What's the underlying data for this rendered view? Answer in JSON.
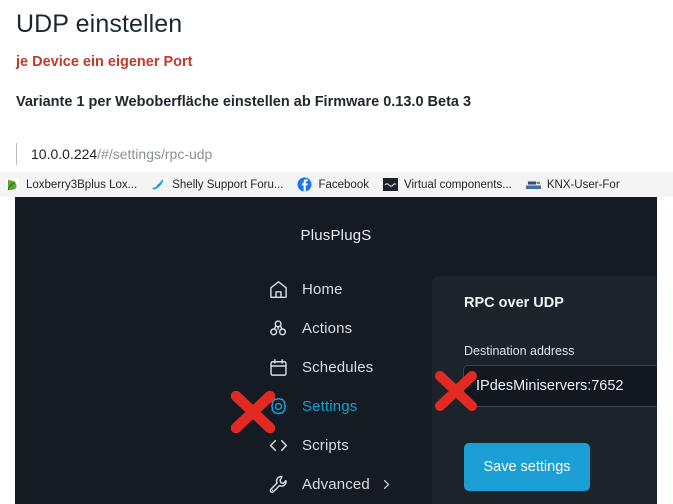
{
  "document": {
    "title": "UDP einstellen",
    "subtitle_red": "je Device ein eigener Port",
    "subtitle_dark": "Variante 1 per Weboberfläche einstellen ab Firmware 0.13.0 Beta 3",
    "colors": {
      "title": "#1b2733",
      "red": "#c0392b",
      "dark": "#20282f"
    }
  },
  "browser": {
    "url_host": "10.0.0.224",
    "url_path": "/#/settings/rpc-udp",
    "bookmarks": [
      {
        "label": "Loxberry3Bplus Lox...",
        "icon": "loxberry-leaf-icon"
      },
      {
        "label": "Shelly Support Foru...",
        "icon": "rss-feed-icon"
      },
      {
        "label": "Facebook",
        "icon": "facebook-icon"
      },
      {
        "label": "Virtual components...",
        "icon": "dark-square-icon"
      },
      {
        "label": "KNX-User-For",
        "icon": "knx-banner-icon"
      }
    ]
  },
  "app": {
    "device_name": "PlusPlugS",
    "colors": {
      "page_bg": "#141b22",
      "card_bg": "#1b232b",
      "accent": "#1b9fd4",
      "annotation_red": "#e32a22"
    },
    "nav": [
      {
        "label": "Home",
        "icon": "home-icon",
        "active": false,
        "chevron": false
      },
      {
        "label": "Actions",
        "icon": "actions-icon",
        "active": false,
        "chevron": false
      },
      {
        "label": "Schedules",
        "icon": "calendar-icon",
        "active": false,
        "chevron": false
      },
      {
        "label": "Settings",
        "icon": "gear-icon",
        "active": true,
        "chevron": false
      },
      {
        "label": "Scripts",
        "icon": "code-brackets-icon",
        "active": false,
        "chevron": false
      },
      {
        "label": "Advanced",
        "icon": "wrench-icon",
        "active": false,
        "chevron": true
      }
    ],
    "card": {
      "title": "RPC over UDP",
      "field_label": "Destination address",
      "field_value": "IPdesMiniservers:7652",
      "field_placeholder": "",
      "save_label": "Save settings"
    }
  },
  "annotations": [
    {
      "name": "x-mark-settings",
      "target": "Settings"
    },
    {
      "name": "x-mark-destination-address",
      "target": "Destination address"
    }
  ]
}
